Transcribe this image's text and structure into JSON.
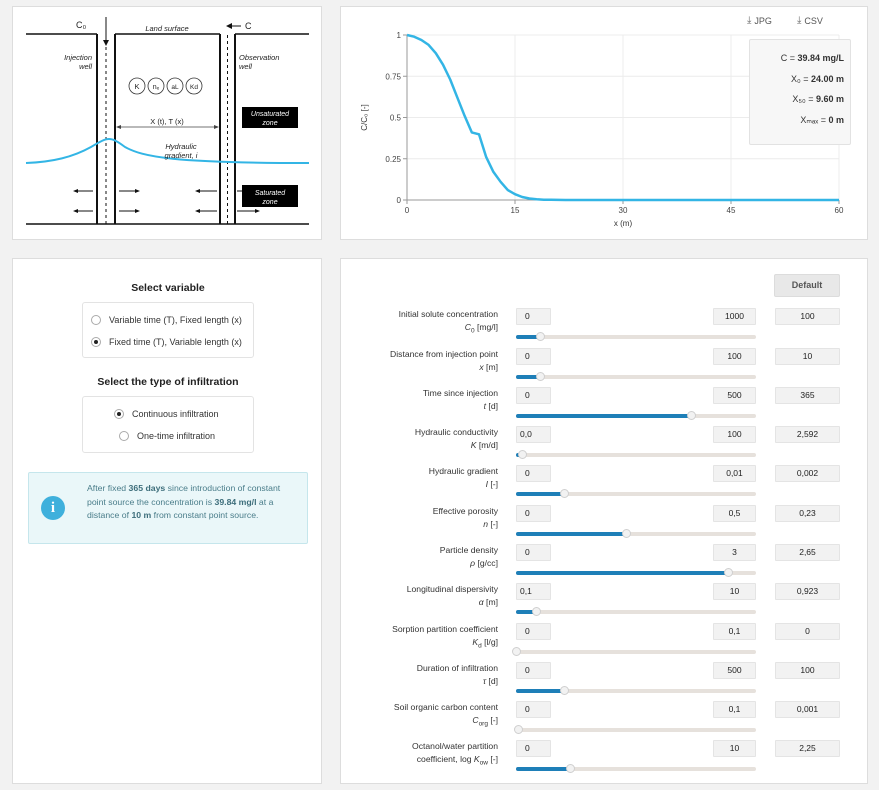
{
  "scheme": {
    "c0_label": "C₀",
    "c_label": "C",
    "land_surface": "Land surface",
    "injection_line1": "Injection",
    "injection_line2": "well",
    "observation_line1": "Observation",
    "observation_line2": "well",
    "circles": [
      "K",
      "nₑ",
      "aL",
      "Kd"
    ],
    "xt_label": "X (t), T (x)",
    "unsaturated_line1": "Unsaturated",
    "unsaturated_line2": "zone",
    "hydraulic_line1": "Hydraulic",
    "hydraulic_line2": "gradient, i",
    "saturated_line1": "Saturated",
    "saturated_line2": "zone"
  },
  "downloads": {
    "jpg": "JPG",
    "csv": "CSV"
  },
  "chart_data": {
    "type": "line",
    "xlabel": "x (m)",
    "ylabel": "C/C₀ [-]",
    "xlim": [
      0,
      60
    ],
    "ylim": [
      0,
      1
    ],
    "xticks": [
      "0",
      "15",
      "30",
      "45",
      "60"
    ],
    "yticks": [
      "0",
      "0.25",
      "0.5",
      "0.75",
      "1"
    ],
    "grid": true,
    "color": "#33b5e5",
    "series": [
      {
        "x": [
          0,
          1,
          2,
          3,
          4,
          5,
          6,
          7,
          8,
          9,
          10,
          11,
          12,
          13,
          14,
          15,
          16,
          17,
          18,
          19,
          20,
          22,
          25,
          30,
          40,
          50,
          60
        ],
        "y": [
          1.0,
          0.99,
          0.97,
          0.94,
          0.89,
          0.82,
          0.73,
          0.62,
          0.51,
          0.41,
          0.3984,
          0.26,
          0.17,
          0.11,
          0.06,
          0.035,
          0.018,
          0.009,
          0.004,
          0.002,
          0.001,
          0.0,
          0.0,
          0.0,
          0.0,
          0.0,
          0.0
        ]
      }
    ]
  },
  "tooltip": {
    "c_label": "C = ",
    "c_value": "39.84 mg/L",
    "x0_label": "X₀ = ",
    "x0_value": "24.00 m",
    "x50_label": "X₅₀ = ",
    "x50_value": "9.60 m",
    "xmax_label": "Xₘₐₓ = ",
    "xmax_value": "0 m"
  },
  "select_variable": {
    "title": "Select variable",
    "options": [
      "Variable time (T), Fixed length (x)",
      "Fixed time (T), Variable length (x)"
    ],
    "selected": 1
  },
  "select_infiltration": {
    "title": "Select the type of infiltration",
    "options": [
      "Continuous infiltration",
      "One-time infiltration"
    ],
    "selected": 0
  },
  "info": {
    "t1": "After fixed ",
    "b1": "365 days",
    "t2": " since introduction of constant point source the concentration is ",
    "b2": "39.84 mg/l",
    "t3": " at a distance of ",
    "b3": "10 m",
    "t4": " from constant point source."
  },
  "params_default_label": "Default",
  "params": [
    {
      "label": "Initial solute concentration",
      "sym": "C",
      "sub": "0",
      "unit": " [mg/l]",
      "min": "0",
      "max": "1000",
      "value": "100",
      "pos": 0.1
    },
    {
      "label": "Distance from injection point",
      "sym": "x",
      "sub": "",
      "unit": " [m]",
      "min": "0",
      "max": "100",
      "value": "10",
      "pos": 0.1
    },
    {
      "label": "Time since injection",
      "sym": "t",
      "sub": "",
      "unit": " [d]",
      "min": "0",
      "max": "500",
      "value": "365",
      "pos": 0.73
    },
    {
      "label": "Hydraulic conductivity",
      "sym": "K",
      "sub": "",
      "unit": " [m/d]",
      "min": "0,0",
      "max": "100",
      "value": "2,592",
      "pos": 0.026
    },
    {
      "label": "Hydraulic gradient",
      "sym": "I",
      "sub": "",
      "unit": " [-]",
      "min": "0",
      "max": "0,01",
      "value": "0,002",
      "pos": 0.2
    },
    {
      "label": "Effective porosity",
      "sym": "n",
      "sub": "",
      "unit": " [-]",
      "min": "0",
      "max": "0,5",
      "value": "0,23",
      "pos": 0.46
    },
    {
      "label": "Particle density",
      "sym": "ρ",
      "sub": "",
      "unit": " [g/cc]",
      "min": "0",
      "max": "3",
      "value": "2,65",
      "pos": 0.883
    },
    {
      "label": "Longitudinal dispersivity",
      "sym": "α",
      "sub": "",
      "unit": " [m]",
      "min": "0,1",
      "max": "10",
      "value": "0,923",
      "pos": 0.083
    },
    {
      "label": "Sorption partition coefficient",
      "sym": "K",
      "sub": "d",
      "unit": " [l/g]",
      "min": "0",
      "max": "0,1",
      "value": "0",
      "pos": 0.0
    },
    {
      "label": "Duration of infiltration",
      "sym": "τ",
      "sub": "",
      "unit": " [d]",
      "min": "0",
      "max": "500",
      "value": "100",
      "pos": 0.2
    },
    {
      "label": "Soil organic carbon content",
      "sym": "C",
      "sub": "org",
      "unit": " [-]",
      "min": "0",
      "max": "0,1",
      "value": "0,001",
      "pos": 0.01
    },
    {
      "label": "Octanol/water partition",
      "label2": "coefficient, log ",
      "sym": "K",
      "sub": "ow",
      "unit": " [-]",
      "min": "0",
      "max": "10",
      "value": "2,25",
      "pos": 0.225
    }
  ]
}
